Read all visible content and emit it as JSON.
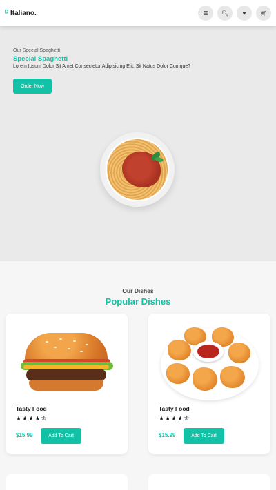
{
  "header": {
    "brand": "Italiano.",
    "icons": [
      "menu-icon",
      "search-icon",
      "heart-icon",
      "cart-icon"
    ]
  },
  "hero": {
    "subtitle": "Our Special Spaghetti",
    "title": "Special Spaghetti",
    "description": "Lorem Ipsum Dolor Sit Amet Consectetur Adipisicing Elit. Sit Natus Dolor Cumque?",
    "button": "Order Now"
  },
  "dishes": {
    "subtitle": "Our Dishes",
    "title": "Popular Dishes",
    "items": [
      {
        "name": "Tasty Food",
        "rating": 4.5,
        "stars": "★★★★⯪",
        "price": "$15.99",
        "button": "Add To Cart"
      },
      {
        "name": "Tasty Food",
        "rating": 4.5,
        "stars": "★★★★⯪",
        "price": "$15.99",
        "button": "Add To Cart"
      }
    ]
  },
  "colors": {
    "accent": "#13c2a6"
  }
}
